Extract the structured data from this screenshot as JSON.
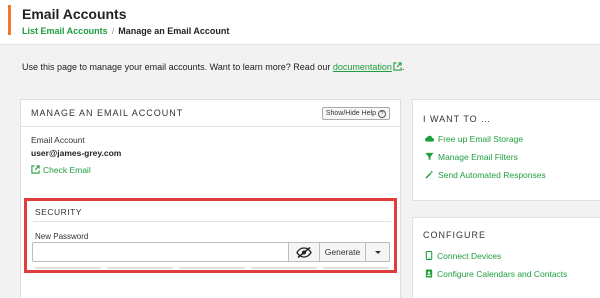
{
  "header": {
    "title": "Email Accounts",
    "breadcrumb": {
      "link": "List Email Accounts",
      "separator": "/",
      "current": "Manage an Email Account"
    }
  },
  "intro": {
    "text": "Use this page to manage your email accounts. Want to learn more? Read our ",
    "link": "documentation",
    "end": "."
  },
  "manage_panel": {
    "title": "MANAGE AN EMAIL ACCOUNT",
    "help_button": "Show/Hide Help",
    "help_icon": "?",
    "account_label": "Email Account",
    "account_value": "user@james-grey.com",
    "check_email": "Check Email"
  },
  "security": {
    "title": "SECURITY",
    "password_label": "New Password",
    "password_value": "",
    "generate_button": "Generate"
  },
  "i_want_to": {
    "title": "I WANT TO …",
    "links": [
      "Free up Email Storage",
      "Manage Email Filters",
      "Send Automated Responses"
    ]
  },
  "configure": {
    "title": "CONFIGURE",
    "links": [
      "Connect Devices",
      "Configure Calendars and Contacts"
    ]
  },
  "colors": {
    "accent": "#f0782d",
    "link": "#1e9e3e",
    "highlight": "#e23d3d"
  }
}
